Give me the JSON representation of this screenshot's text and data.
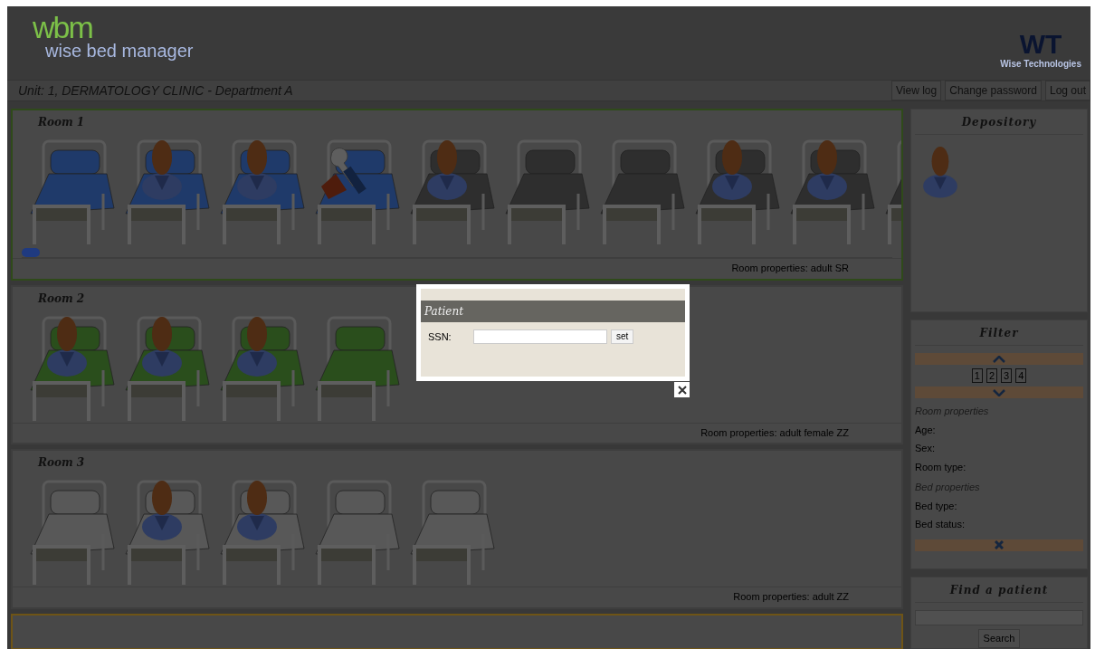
{
  "header": {
    "logo_mark": "wbm",
    "logo_text": "wise bed manager",
    "company_mark": "WT",
    "company_name": "Wise Technologies"
  },
  "unit_bar": {
    "title": "Unit: 1, DERMATOLOGY CLINIC - Department A",
    "links": [
      "View log",
      "Change password",
      "Log out"
    ]
  },
  "rooms": [
    {
      "title": "Room 1",
      "color": "#2f4a1a",
      "scrollable": true,
      "properties": "Room properties: adult SR",
      "beds": [
        {
          "color": "#1f3a6a",
          "kind": "empty"
        },
        {
          "color": "#1f3a6a",
          "kind": "patient"
        },
        {
          "color": "#1f3a6a",
          "kind": "patient"
        },
        {
          "color": "#1f3a6a",
          "kind": "repair"
        },
        {
          "color": "#2e2e2e",
          "kind": "patient"
        },
        {
          "color": "#2e2e2e",
          "kind": "empty"
        },
        {
          "color": "#2e2e2e",
          "kind": "empty"
        },
        {
          "color": "#2e2e2e",
          "kind": "patient"
        },
        {
          "color": "#2e2e2e",
          "kind": "patient"
        },
        {
          "color": "#2e2e2e",
          "kind": "empty"
        }
      ]
    },
    {
      "title": "Room 2",
      "scrollable": false,
      "properties": "Room properties: adult female ZZ",
      "beds": [
        {
          "color": "#2a4e1c",
          "kind": "patient"
        },
        {
          "color": "#2a4e1c",
          "kind": "patient"
        },
        {
          "color": "#2a4e1c",
          "kind": "patient"
        },
        {
          "color": "#2a4e1c",
          "kind": "empty"
        }
      ]
    },
    {
      "title": "Room 3",
      "scrollable": false,
      "properties": "Room properties: adult ZZ",
      "beds": [
        {
          "color": "#585858",
          "kind": "empty"
        },
        {
          "color": "#585858",
          "kind": "patient"
        },
        {
          "color": "#585858",
          "kind": "patient"
        },
        {
          "color": "#585858",
          "kind": "empty"
        },
        {
          "color": "#585858",
          "kind": "empty"
        }
      ]
    }
  ],
  "next_room": {
    "color": "#6e5416"
  },
  "depository": {
    "title": "Depository",
    "items": [
      {
        "kind": "patient"
      }
    ]
  },
  "filter": {
    "title": "Filter",
    "pages": [
      "1",
      "2",
      "3",
      "4"
    ],
    "room_heading": "Room properties",
    "room_fields": [
      "Age:",
      "Sex:",
      "Room type:"
    ],
    "bed_heading": "Bed properties",
    "bed_fields": [
      "Bed type:",
      "Bed status:"
    ]
  },
  "find_patient": {
    "title": "Find a patient",
    "button": "Search"
  },
  "dialog": {
    "title": "Patient",
    "label": "SSN:",
    "button": "set"
  }
}
